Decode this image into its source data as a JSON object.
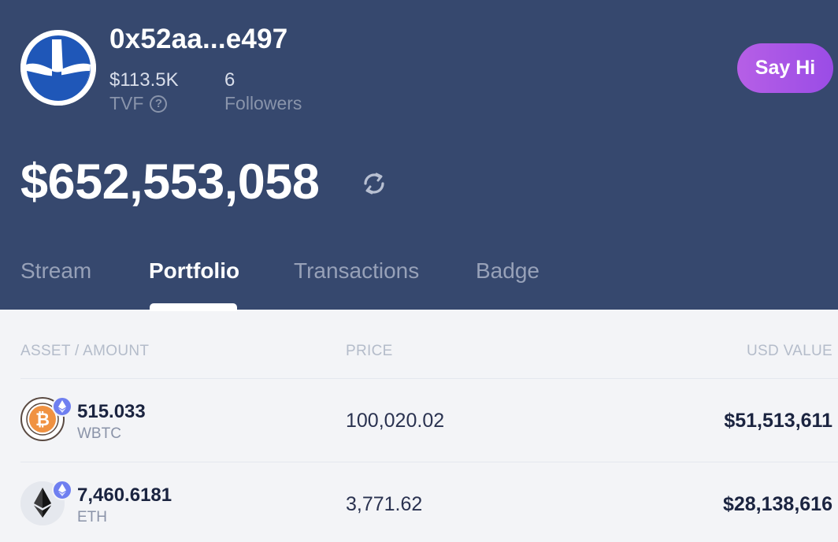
{
  "profile": {
    "address": "0x52aa...e497",
    "tvf_value": "$113.5K",
    "tvf_label": "TVF",
    "followers_count": "6",
    "followers_label": "Followers",
    "say_hi_label": "Say Hi",
    "help_icon": "question-circle-icon"
  },
  "total_value": "$652,553,058",
  "tabs": [
    {
      "label": "Stream",
      "active": false
    },
    {
      "label": "Portfolio",
      "active": true
    },
    {
      "label": "Transactions",
      "active": false
    },
    {
      "label": "Badge",
      "active": false
    }
  ],
  "table": {
    "headers": {
      "asset": "ASSET / AMOUNT",
      "price": "PRICE",
      "usd": "USD VALUE"
    },
    "rows": [
      {
        "amount": "515.033",
        "symbol": "WBTC",
        "price": "100,020.02",
        "usd_value": "$51,513,611",
        "icon": "wbtc-icon",
        "chain_icon": "ethereum-chain-icon"
      },
      {
        "amount": "7,460.6181",
        "symbol": "ETH",
        "price": "3,771.62",
        "usd_value": "$28,138,616",
        "icon": "eth-icon",
        "chain_icon": "ethereum-chain-icon"
      }
    ]
  },
  "colors": {
    "header_bg": "#36486e",
    "accent_purple": "#b65fe6",
    "page_bg": "#f3f4f7"
  }
}
